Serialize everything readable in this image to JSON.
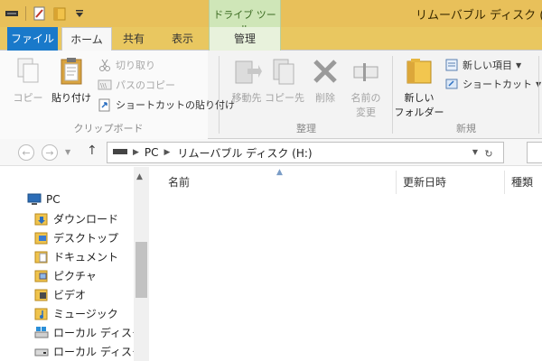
{
  "window": {
    "title": "リムーバブル ディスク (H:",
    "context_tab_header": "ドライブ ツール"
  },
  "tabs": {
    "file": "ファイル",
    "home": "ホーム",
    "share": "共有",
    "view": "表示",
    "manage": "管理"
  },
  "ribbon": {
    "clipboard": {
      "label": "クリップボード",
      "copy": "コピー",
      "paste": "貼り付け",
      "cut": "切り取り",
      "copy_path": "パスのコピー",
      "paste_shortcut": "ショートカットの貼り付け"
    },
    "organize": {
      "label": "整理",
      "move_to": "移動先",
      "copy_to": "コピー先",
      "delete": "削除",
      "rename_line1": "名前の",
      "rename_line2": "変更"
    },
    "new": {
      "label": "新規",
      "new_folder_line1": "新しい",
      "new_folder_line2": "フォルダー",
      "new_item": "新しい項目",
      "shortcut": "ショートカット"
    }
  },
  "address": {
    "crumbs": [
      "PC",
      "リムーバブル ディスク (H:)"
    ]
  },
  "columns": {
    "name": "名前",
    "date_modified": "更新日時",
    "type": "種類"
  },
  "nav_items": [
    {
      "label": "PC",
      "icon": "pc-icon"
    },
    {
      "label": "ダウンロード",
      "icon": "downloads-folder-icon"
    },
    {
      "label": "デスクトップ",
      "icon": "desktop-folder-icon"
    },
    {
      "label": "ドキュメント",
      "icon": "documents-folder-icon"
    },
    {
      "label": "ピクチャ",
      "icon": "pictures-folder-icon"
    },
    {
      "label": "ビデオ",
      "icon": "videos-folder-icon"
    },
    {
      "label": "ミュージック",
      "icon": "music-folder-icon"
    },
    {
      "label": "ローカル ディスク (C",
      "icon": "local-disk-icon"
    },
    {
      "label": "ローカル ディスク (E",
      "icon": "local-disk-icon"
    }
  ],
  "colors": {
    "title_bar": "#e8c05a",
    "file_tab": "#1979ca",
    "context_tab": "#cfe6b8"
  }
}
